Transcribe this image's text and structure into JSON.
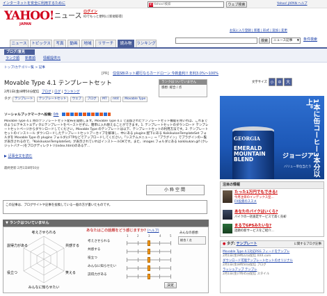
{
  "top": {
    "notice_link": "インターネットを安全に利用するために",
    "search_placeholder": "Yahoo!検索",
    "search_button": "ウェブ検索",
    "links": [
      "Yahoo! JAPAN ヘルプ"
    ]
  },
  "brand": {
    "logo": "YAHOO!",
    "logo_sub": "JAPAN",
    "section": "ニュース",
    "login_link": "ログイン",
    "login_sub": "IDでもっと便利に[新規取得]",
    "settings_links": "お気に入り登録 | 新着 | 形式 | 追加 | 変更"
  },
  "search": {
    "button": "検索",
    "scope": "ニュース記事",
    "condition_link": "条件検索"
  },
  "tabs": [
    "ニュース",
    "トピックス",
    "写真",
    "動画",
    "地域",
    "リサーチ",
    "読み物",
    "ランキング"
  ],
  "subnav": {
    "section_label": "ブログ/意見",
    "items": [
      "ランク順",
      "新着順",
      "情報提供元"
    ]
  },
  "breadcrumb": "トップ/カテゴリ一覧 > 記事",
  "promo": {
    "tag": "[PR]",
    "text": "住信SBIネット銀行ならカードローン 今新金利!! 年利3.0%〜100%"
  },
  "article": {
    "title": "Movable Type 4.1 テンプレートセット",
    "meta": "2月1日(金)8時50分配信",
    "source": "ブログ",
    "links": [
      "ログ",
      "ランキング"
    ],
    "tags_label": "タグ:",
    "tags": [
      "テンプレート",
      "テンプレートセット",
      "ウェブ",
      "ブログ",
      "MT",
      "mt4",
      "Movable Type"
    ],
    "social_label": "ソーシャルブックマークへ投稿:",
    "social_count": "0件",
    "body": "Movable Type 4.1 用のテンプレートセット配布を開始します。Movable Type 4.1 で追加されたテンプレートセット機能を用いれば、これまでのようにテキストエディタにテンプレートをペーストせずに、簡単に入れ替えることができます。1. テンプレートセットのダウンロード テンプレートセットページからダウンロードしてください。Movable Type のテンプレートは以下、テンプレートセットの利用方法です。2. テンプレートセットのインストール ダウンロードしたテンプレートセットアーカイブを解凍し、中にある plugins 配下にある KoikikukanTemplateSet フォルダを Movable Type の plugins フォルダにFTPなどでアップロードしてください。「システムメニュー」→「プラグイン」でプラグインの一覧が表示されるので、「KoikikukanTemplateSet」が表示されていればインストールOKです。また、images フォルダにある koikikukan.gif (クレジットバナー)をブログディレクトリ(index.html)のあるデ...",
    "full_link": "記事全文を読む",
    "updated": "最終更新:2月1日8時50分",
    "blog_name": "小粋空間"
  },
  "rating_box": {
    "title": "ランクはついていません",
    "label": "感想:",
    "value": "総合 / 点"
  },
  "font_size": {
    "label": "文字サイズ",
    "options": [
      "小",
      "中",
      "大"
    ]
  },
  "disclaimer": "この記事は、ブログサイトや記事を投稿している一般の方が書いたものです。",
  "rank_section": {
    "title": "ランクはついていません",
    "question": "あなたはこの話題をどう感じますか?",
    "question_sub": "[ヘルプ]",
    "radar_labels": [
      "考えさせられる",
      "共感する",
      "笑える",
      "みんなに知らせたい",
      "役立つ",
      "説得力がある"
    ],
    "sliders": [
      "考えさせられる",
      "共感する",
      "役立つ",
      "みんなに知らせたい",
      "説得力がある"
    ],
    "slider_values": [
      3,
      3,
      3,
      3,
      3
    ],
    "scale": [
      "1",
      "2",
      "3",
      "4",
      "5"
    ],
    "submit": "決定",
    "side_title": "みんなの感想:",
    "side_value": "総合 / 点"
  },
  "ad": {
    "text_big": "1本に缶コーヒー3本分以上。",
    "text_mid": "ジョージア",
    "can1": "GEORGIA",
    "can2": "EMERALD MOUNTAIN BLEND",
    "text_small": "バリュー単位当たり"
  },
  "side_news": {
    "title": "注目の情報",
    "item1_title": "たった1万円でもできる!",
    "item1_text": "今月注目のインデックス型...",
    "item1_link": "FX投資のススメ",
    "item2_title": "あなたのバイクはいくら?",
    "item2_text": "バイクの一括査定サービスで高く売却",
    "item2_link": "バイク買取",
    "item3_title": "まるでGPSみたいな?",
    "item3_text": "話題の新サービスをご紹介...",
    "item3_link": "今すぐチェック"
  },
  "tag_widget": {
    "label": "タグ:",
    "value": "テンプレート",
    "sub": "に関するブログ記事",
    "items": [
      "Movable Type 4.1対応RSS フィードをテンプレ",
      "2月1日(金)9時22分配信 XXX.com",
      "ダウンロード可能テンプレートセットのオリジナル",
      "2月1日(金)8時50分配信 ブログ",
      "ラッシュアップ テンプレ",
      "2月1日(金)7時45分配信 スタイル"
    ]
  },
  "colors": {
    "accent": "#4a5e9a",
    "logo_red": "#d1001c",
    "link": "#1a3fa8",
    "ad_blue": "#1d58b7",
    "slider_knob": "#f59a1c"
  }
}
